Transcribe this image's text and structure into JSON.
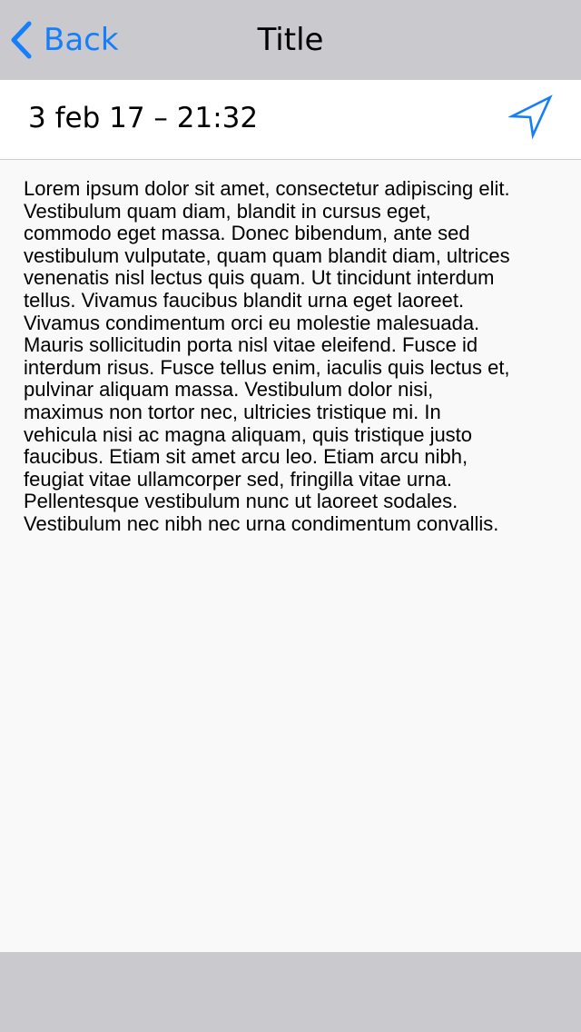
{
  "navbar": {
    "back_label": "Back",
    "title": "Title",
    "accent_color": "#147efb",
    "back_icon": "chevron-left-icon"
  },
  "entry": {
    "date": "3 feb 17 – 21:32",
    "location_icon": "location-arrow-icon",
    "body": "Lorem ipsum dolor sit amet, consectetur adipiscing elit.\nVestibulum quam diam, blandit in cursus eget,\ncommodo eget massa. Donec bibendum, ante sed\nvestibulum vulputate, quam quam blandit diam, ultrices\nvenenatis nisl lectus quis quam. Ut tincidunt interdum\ntellus. Vivamus faucibus blandit urna eget laoreet.\nVivamus condimentum orci eu molestie malesuada.\nMauris sollicitudin porta nisl vitae eleifend. Fusce id\ninterdum risus. Fusce tellus enim, iaculis quis lectus et,\npulvinar aliquam massa. Vestibulum dolor nisi,\nmaximus non tortor nec, ultricies tristique mi. In\nvehicula nisi ac magna aliquam, quis tristique justo\nfaucibus. Etiam sit amet arcu leo. Etiam arcu nibh,\nfeugiat vitae ullamcorper sed, fringilla vitae urna.\nPellentesque vestibulum nunc ut laoreet sodales.\nVestibulum nec nibh nec urna condimentum convallis."
  }
}
